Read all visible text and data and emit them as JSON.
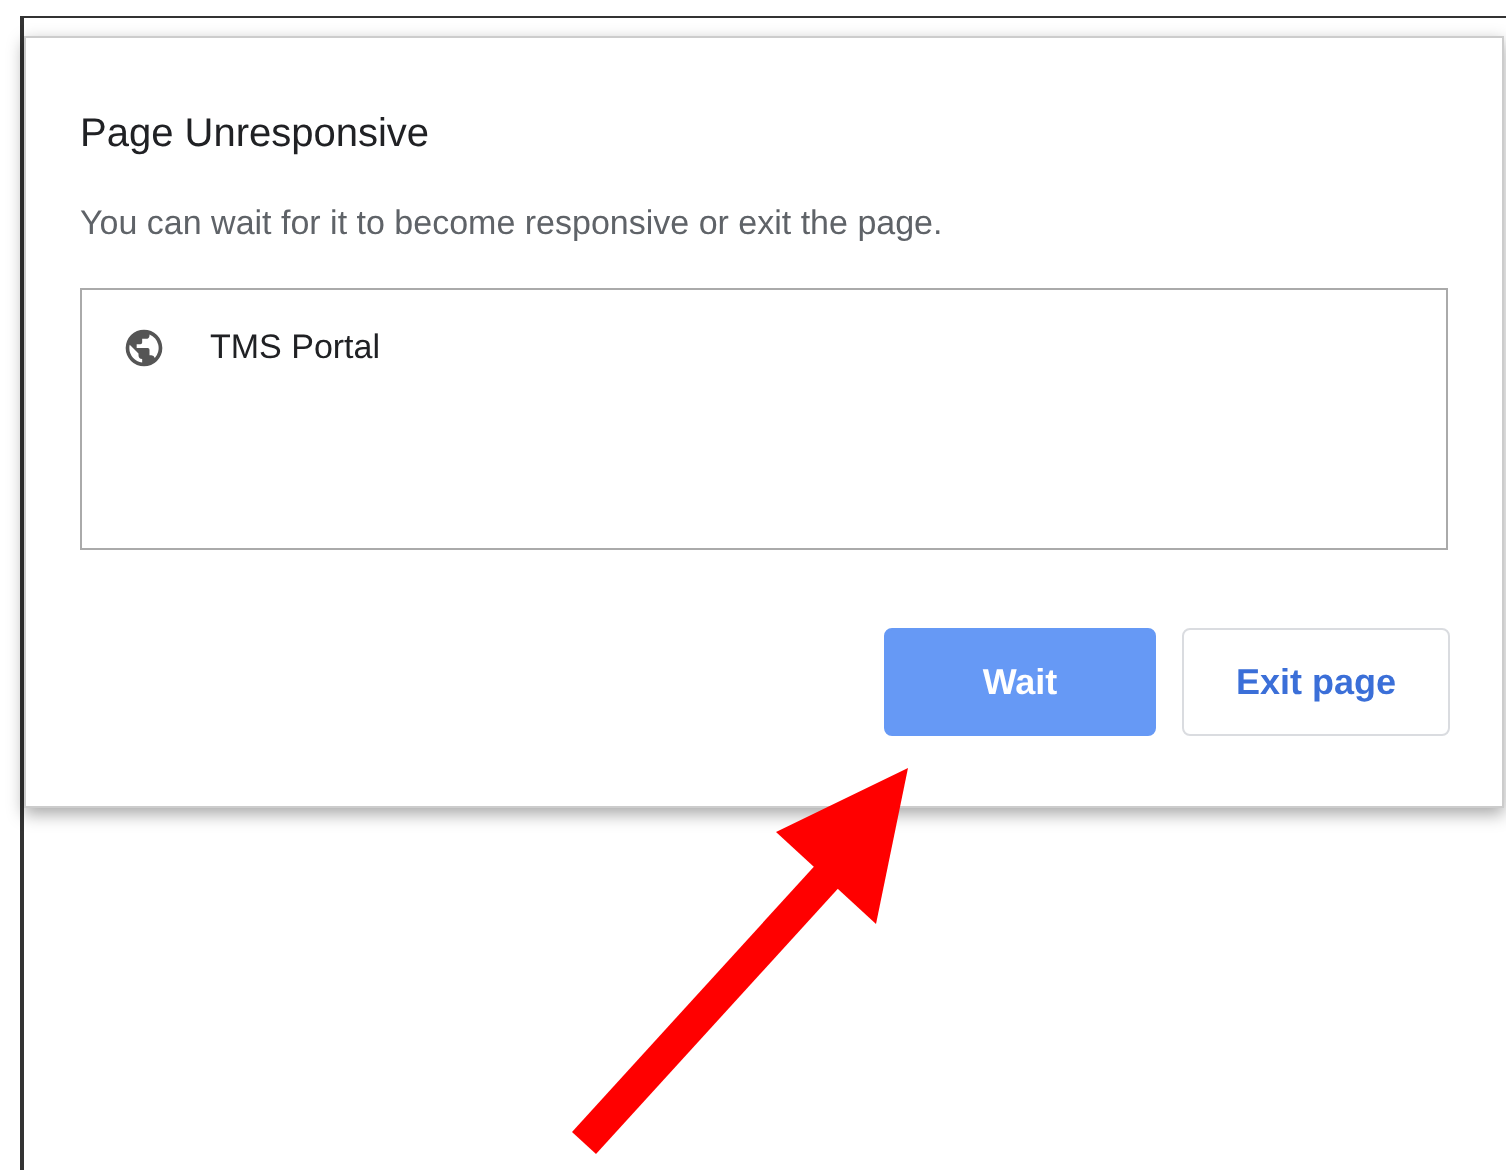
{
  "dialog": {
    "title": "Page Unresponsive",
    "message": "You can wait for it to become responsive or exit the page.",
    "pages": [
      {
        "title": "TMS Portal"
      }
    ],
    "buttons": [
      {
        "label": "Wait",
        "kind": "primary"
      },
      {
        "label": "Exit page",
        "kind": "secondary"
      }
    ]
  }
}
